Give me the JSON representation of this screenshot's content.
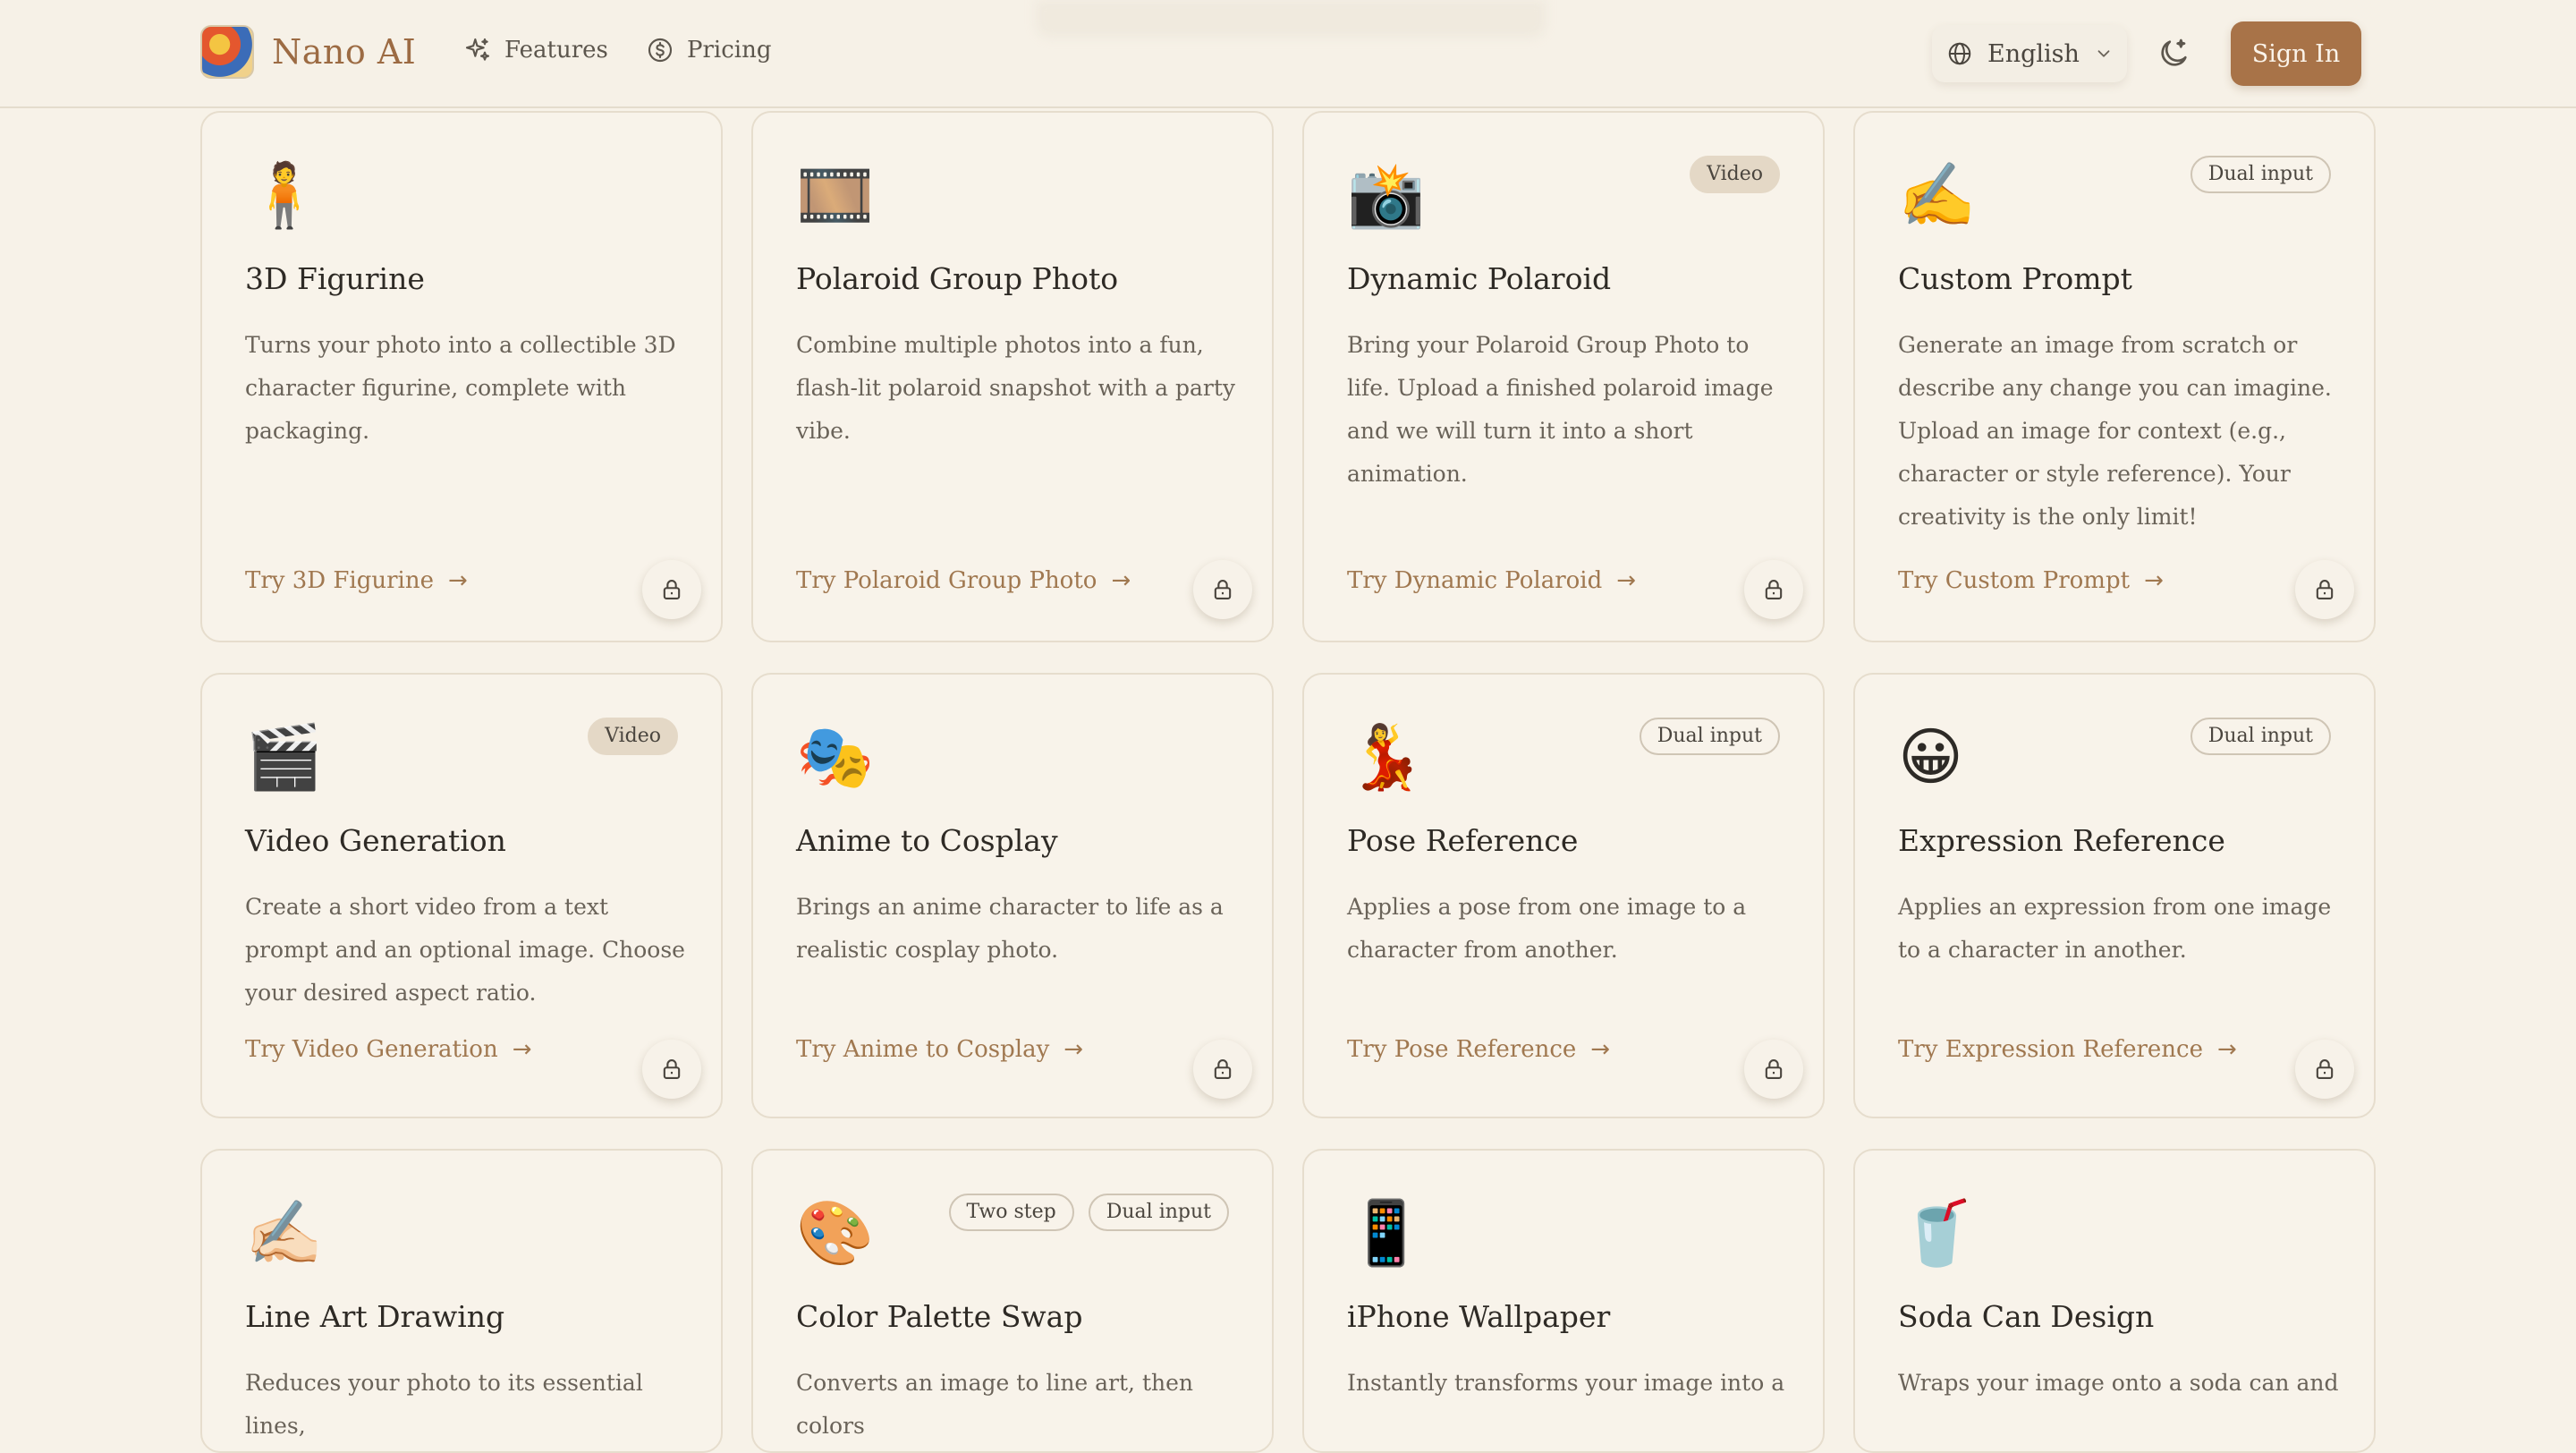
{
  "header": {
    "brand_name": "Nano AI",
    "brand_logo_icon": "nano-ai-logo",
    "nav": [
      {
        "label": "Features",
        "icon": "sparkles-icon"
      },
      {
        "label": "Pricing",
        "icon": "dollar-circle-icon"
      }
    ],
    "language": {
      "label": "English",
      "icon": "globe-icon"
    },
    "theme_toggle_icon": "moon-sparkle-icon",
    "sign_in_label": "Sign In"
  },
  "colors": {
    "background": "#f7f2e8",
    "accent": "#a87348",
    "card_border": "#e6ddcd",
    "link": "#a07850"
  },
  "cards": [
    {
      "emoji": "🧍",
      "title": "3D Figurine",
      "badges": [],
      "description": "Turns your photo into a collectible 3D character figurine, complete with packaging.",
      "cta": "Try 3D Figurine",
      "locked": true
    },
    {
      "emoji": "🎞️",
      "title": "Polaroid Group Photo",
      "badges": [],
      "description": "Combine multiple photos into a fun, flash-lit polaroid snapshot with a party vibe.",
      "cta": "Try Polaroid Group Photo",
      "locked": true
    },
    {
      "emoji": "📸",
      "title": "Dynamic Polaroid",
      "badges": [
        "Video"
      ],
      "description": "Bring your Polaroid Group Photo to life. Upload a finished polaroid image and we will turn it into a short animation.",
      "cta": "Try Dynamic Polaroid",
      "locked": true
    },
    {
      "emoji": "✍️",
      "title": "Custom Prompt",
      "badges": [
        "Dual input"
      ],
      "description": "Generate an image from scratch or describe any change you can imagine. Upload an image for context (e.g., character or style reference). Your creativity is the only limit!",
      "cta": "Try Custom Prompt",
      "locked": true
    },
    {
      "emoji": "🎬",
      "title": "Video Generation",
      "badges": [
        "Video"
      ],
      "description": "Create a short video from a text prompt and an optional image. Choose your desired aspect ratio.",
      "cta": "Try Video Generation",
      "locked": true
    },
    {
      "emoji": "🎭",
      "title": "Anime to Cosplay",
      "badges": [],
      "description": "Brings an anime character to life as a realistic cosplay photo.",
      "cta": "Try Anime to Cosplay",
      "locked": true
    },
    {
      "emoji": "💃",
      "title": "Pose Reference",
      "badges": [
        "Dual input"
      ],
      "description": "Applies a pose from one image to a character from another.",
      "cta": "Try Pose Reference",
      "locked": true
    },
    {
      "emoji": "😀",
      "title": "Expression Reference",
      "badges": [
        "Dual input"
      ],
      "description": "Applies an expression from one image to a character in another.",
      "cta": "Try Expression Reference",
      "locked": true
    },
    {
      "emoji": "✍🏻",
      "title": "Line Art Drawing",
      "badges": [],
      "description": "Reduces your photo to its essential lines,",
      "cta": "",
      "locked": true
    },
    {
      "emoji": "🎨",
      "title": "Color Palette Swap",
      "badges": [
        "Two step",
        "Dual input"
      ],
      "description": "Converts an image to line art, then colors",
      "cta": "",
      "locked": true
    },
    {
      "emoji": "📱",
      "title": "iPhone Wallpaper",
      "badges": [],
      "description": "Instantly transforms your image into a",
      "cta": "",
      "locked": true
    },
    {
      "emoji": "🥤",
      "title": "Soda Can Design",
      "badges": [],
      "description": "Wraps your image onto a soda can and",
      "cta": "",
      "locked": true
    }
  ]
}
